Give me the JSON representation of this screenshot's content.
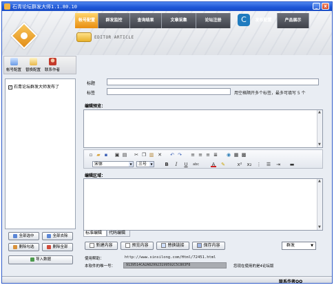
{
  "window": {
    "title": "石青论坛群发大师1.1.80.10",
    "minimize": "_",
    "close": "x"
  },
  "menu": {
    "items": [
      {
        "label": "帐号配置",
        "active": true
      },
      {
        "label": "群发监控",
        "active": false
      },
      {
        "label": "查询结果",
        "active": false
      },
      {
        "label": "文章采集",
        "active": false
      },
      {
        "label": "论坛注册",
        "active": false
      },
      {
        "label": "发布配置",
        "active": false
      },
      {
        "label": "产品展示",
        "active": false
      }
    ]
  },
  "banner": {
    "editor_label": "EDITOR ARTICLE"
  },
  "toolstrip": {
    "items": [
      {
        "label": "帐号配置",
        "icon": "account-config-icon"
      },
      {
        "label": "替换配置",
        "icon": "replace-config-icon"
      },
      {
        "label": "联系作者",
        "icon": "contact-author-icon"
      }
    ]
  },
  "accounts": {
    "items": [
      {
        "label": "石青论坛群发大师发布了",
        "checked": true
      }
    ]
  },
  "left_buttons": {
    "select_all": "全部选中",
    "deselect_all": "全部去除",
    "delete_checked": "删除勾选",
    "delete_all": "删除全部",
    "import": "导入数据"
  },
  "form": {
    "title_label": "标题",
    "title_value": "",
    "tags_label": "标签",
    "tags_value": "",
    "tags_hint": "用空格隔开多个标签，最多可填写 5 个"
  },
  "preview": {
    "title": "编辑预览："
  },
  "editor": {
    "font_value": "宋体",
    "size_value": "三号",
    "area_title": "编辑区域：",
    "tabs": [
      "标准编辑",
      "代码编辑"
    ]
  },
  "actions": {
    "new": "新建内容",
    "preview": "预览内容",
    "replace": "替换链接",
    "save": "保存内容",
    "mode": "群发"
  },
  "info": {
    "help_label": "使用帮助：",
    "help_url": "http://www.sinsilong.com/Html/72451.html",
    "key_label": "本软件的唯一号：",
    "key_value": "9139514CA2A829923199592C5C803F8",
    "user_label": "您现在使用的是4论坛版"
  },
  "status": {
    "text": "联系作者QQ"
  }
}
